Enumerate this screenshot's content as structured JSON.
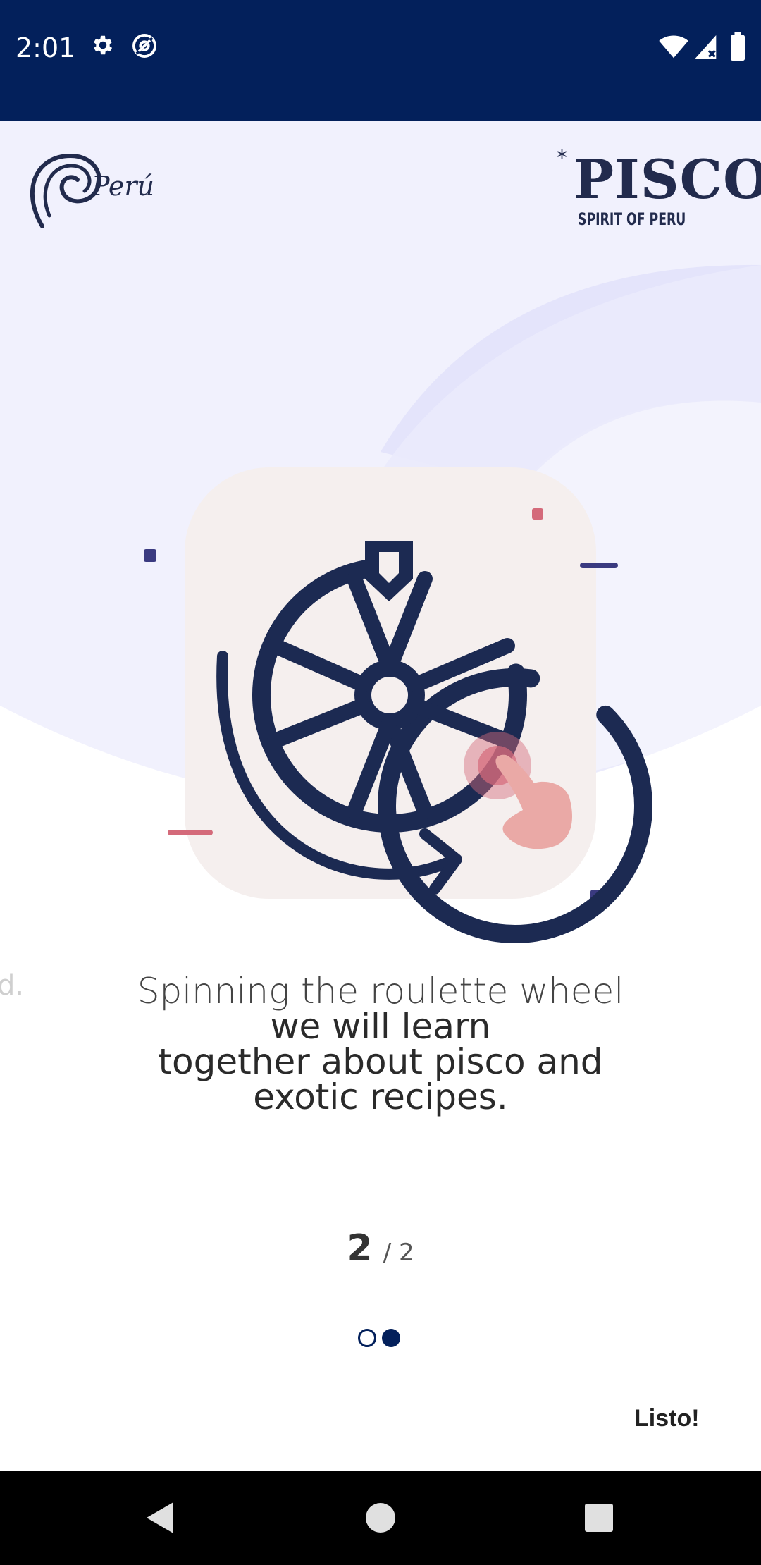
{
  "status_bar": {
    "time": "2:01",
    "icons": [
      "settings-icon",
      "at-sign-icon",
      "wifi-icon",
      "signal-icon",
      "battery-icon"
    ],
    "background": "#03205b"
  },
  "header": {
    "left_logo_text": "Perú",
    "right_logo_main": "PISCO",
    "right_logo_star": "*",
    "right_logo_sub": "SPIRIT OF PERU"
  },
  "illustration": {
    "icon": "roulette-wheel-tap-icon",
    "colors": {
      "card": "#f5efee",
      "wheel": "#1c2a52",
      "accent": "#d46a7a",
      "hand": "#eaa9a6",
      "square": "#3a3a80"
    }
  },
  "onboarding": {
    "ghost_text": "d.",
    "caption_line1": "Spinning the roulette wheel",
    "caption_rest": "we will learn\ntogether about pisco and\nexotic recipes.",
    "page_current": "2",
    "page_total_label": "/ 2",
    "dots_active_index": 2,
    "done_label": "Listo!"
  },
  "nav_bar": {
    "buttons": [
      "back-icon",
      "home-icon",
      "recents-icon"
    ]
  }
}
